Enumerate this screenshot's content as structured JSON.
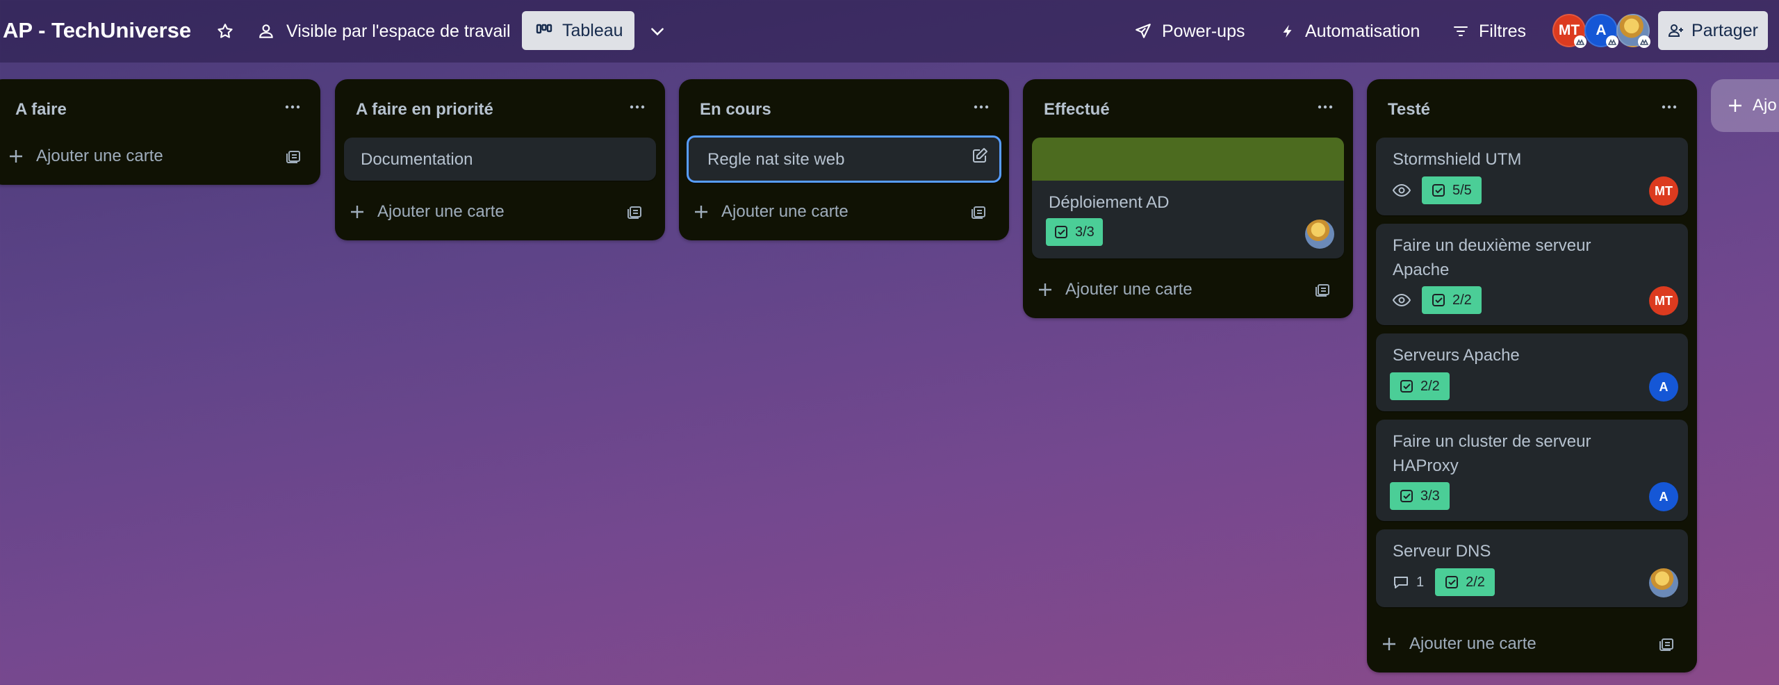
{
  "header": {
    "board_title": "AP - TechUniverse",
    "visibility_label": "Visible par l'espace de travail",
    "view_label": "Tableau",
    "powerups_label": "Power-ups",
    "automation_label": "Automatisation",
    "filters_label": "Filtres",
    "share_label": "Partager",
    "members": [
      {
        "initials": "MT",
        "color": "#dc3b1f"
      },
      {
        "initials": "A",
        "color": "#1557d6"
      },
      {
        "initials": "",
        "type": "image-avatar"
      }
    ]
  },
  "lists": [
    {
      "title": "A faire",
      "add_label": "Ajouter une carte",
      "cards": []
    },
    {
      "title": "A faire en priorité",
      "add_label": "Ajouter une carte",
      "cards": [
        {
          "title": "Documentation"
        }
      ]
    },
    {
      "title": "En cours",
      "add_label": "Ajouter une carte",
      "cards": [
        {
          "title": "Regle nat site web",
          "focused": true
        }
      ]
    },
    {
      "title": "Effectué",
      "add_label": "Ajouter une carte",
      "cards": [
        {
          "title": "Déploiement AD",
          "cover_color": "#4c6b1f",
          "checklist": "3/3",
          "member": "image-avatar"
        }
      ]
    },
    {
      "title": "Testé",
      "add_label": "Ajouter une carte",
      "cards": [
        {
          "title": "Stormshield UTM",
          "watching": true,
          "checklist": "5/5",
          "member": "MT"
        },
        {
          "title_line1": "Faire un deuxième serveur",
          "title_line2": "Apache",
          "watching": true,
          "checklist": "2/2",
          "member": "MT"
        },
        {
          "title": "Serveurs Apache",
          "checklist": "2/2",
          "member": "A"
        },
        {
          "title_line1": "Faire un cluster de serveur",
          "title_line2": "HAProxy",
          "checklist": "3/3",
          "member": "A"
        },
        {
          "title": "Serveur DNS",
          "comments": "1",
          "checklist": "2/2",
          "member": "image-avatar"
        }
      ]
    }
  ],
  "add_list_label": "Ajo",
  "colors": {
    "list_bg": "#101204",
    "card_bg": "#22272b",
    "checklist_done": "#4bce97",
    "focus_ring": "#579dff"
  }
}
